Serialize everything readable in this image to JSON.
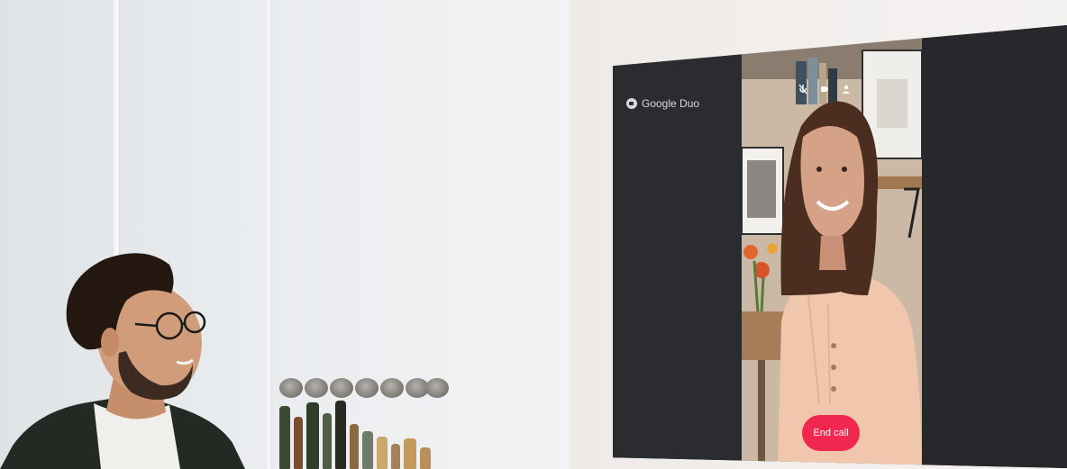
{
  "app": {
    "name": "Google Duo"
  },
  "call": {
    "end_call_label": "End call"
  },
  "controls": {
    "icons": [
      "microphone-off-icon",
      "video-camera-icon",
      "person-icon"
    ]
  },
  "colors": {
    "tv_background": "#27292d",
    "end_call_button": "#f0284f",
    "logo_text": "#d7d9dc"
  }
}
